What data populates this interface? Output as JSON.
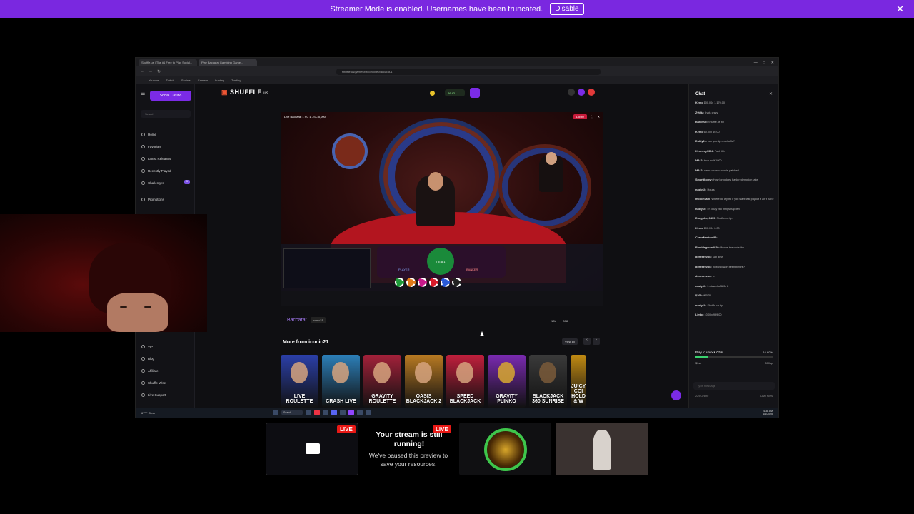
{
  "banner": {
    "message": "Streamer Mode is enabled. Usernames have been truncated.",
    "disable_label": "Disable",
    "close_icon": "close-icon"
  },
  "browser": {
    "tabs": [
      {
        "label": "Shuffle.us | The #1 Free to Play Social..."
      },
      {
        "label": "Play Baccarat Gambling Game..."
      }
    ],
    "url": "shuffle.us/games/bitcoin-live-baccarat-1",
    "bookmarks": [
      "Youtube",
      "Twitch",
      "Socials",
      "Camera",
      "hunting",
      "Trading"
    ]
  },
  "sidebar": {
    "social_casino_label": "Social Casino",
    "search_placeholder": "Search",
    "items": [
      {
        "label": "Home"
      },
      {
        "label": "Favorites"
      },
      {
        "label": "Latest Releases"
      },
      {
        "label": "Recently Played"
      },
      {
        "label": "Challenges"
      },
      {
        "label": "Promotions"
      },
      {
        "label": "VIP"
      },
      {
        "label": "Blog"
      },
      {
        "label": "Affiliate"
      },
      {
        "label": "Shuffle Wise"
      },
      {
        "label": "Live Support"
      }
    ],
    "challenges_badge": "5"
  },
  "header": {
    "logo_text": "SHUFFLE",
    "logo_suffix": ".us",
    "balance": "26.42"
  },
  "game": {
    "topbar_title": "Live Baccarat 1 SC 1 - SC 5,000",
    "lobby_label": "Lobby",
    "player_label": "PLAYER",
    "banker_label": "BANKER",
    "tie_label": "TIE 8:1",
    "title": "Baccarat",
    "provider": "iconic21",
    "stat_players": "12k",
    "stat_value": "008",
    "more_from": "More from iconic21",
    "view_all": "View all"
  },
  "cards": [
    {
      "label": "LIVE ROULETTE",
      "color": "#2b3fa8"
    },
    {
      "label": "CRASH LIVE",
      "color": "#2c7fb8"
    },
    {
      "label": "GRAVITY ROULETTE",
      "color": "#a3213a"
    },
    {
      "label": "OASIS BLACKJACK 2",
      "color": "#b87a22"
    },
    {
      "label": "SPEED BLACKJACK",
      "color": "#c01f3c"
    },
    {
      "label": "GRAVITY PLINKO",
      "color": "#7a2ab0"
    },
    {
      "label": "BLACKJACK 360 SUNRISE",
      "color": "#3a3a3a"
    },
    {
      "label": "JUICY COI HOLD & W",
      "color": "#c08a12"
    }
  ],
  "chat": {
    "title": "Chat",
    "messages": [
      {
        "user": "Kemo",
        "text": "100.00x  1,170.00"
      },
      {
        "user": "Zvbltz:",
        "text": "thats crazy"
      },
      {
        "user": "Banc005:",
        "text": "Shuffle.us tip"
      },
      {
        "user": "Kemo",
        "text": "60.00x  60.00"
      },
      {
        "user": "Diddy2x:",
        "text": "can you tip on shuffle?"
      },
      {
        "user": "Kennedy0324:",
        "text": "Fuck this"
      },
      {
        "user": "M342:",
        "text": "tech built 1000"
      },
      {
        "user": "M342:",
        "text": "damn chased rookie patched"
      },
      {
        "user": "Smartthorny:",
        "text": "How long does bank redemption take"
      },
      {
        "user": "nasty10:",
        "text": "Hours"
      },
      {
        "user": "moochsam:",
        "text": "Where do crypto if you want fast payout it ain't hard to learn to do crypto lol"
      },
      {
        "user": "nasty10:",
        "text": "It's okay bro things happen"
      },
      {
        "user": "Doughboy0409:",
        "text": "Shuffle.us tip"
      },
      {
        "user": "Kemo",
        "text": "100.00x  0.00"
      },
      {
        "user": "CraneMasters99:",
        "text": ""
      },
      {
        "user": "Rumblegman2020:",
        "text": "Where the code tho"
      },
      {
        "user": "deeeeeezon:",
        "text": "sup guys"
      },
      {
        "user": "deeeeeezon:",
        "text": "how yall won been before?"
      },
      {
        "user": "deeeeeezon:",
        "text": "w"
      },
      {
        "user": "nasty10:",
        "text": "I missed a 380x L"
      },
      {
        "user": "$369:",
        "text": "WBTR"
      },
      {
        "user": "nasty10:",
        "text": "Shuffle.us tip"
      },
      {
        "user": "Limbo",
        "text": "10.00x  999.00"
      }
    ],
    "unlock_label": "Play to unlock Chat",
    "unlock_percent": "16.60%",
    "unlock_fraction": 0.166,
    "wager_left": "$0sp",
    "wager_right": "500sp",
    "input_placeholder": "Type message",
    "online": "229 Online",
    "rules": "Chat rules"
  },
  "taskbar": {
    "weather": "67°F Clear",
    "search": "Search",
    "clock_time": "4:38 AM",
    "clock_date": "6/6/2025"
  },
  "previews": {
    "live_label": "LIVE",
    "paused_title": "Your stream is still running!",
    "paused_sub": "We've paused this preview to save your resources."
  }
}
